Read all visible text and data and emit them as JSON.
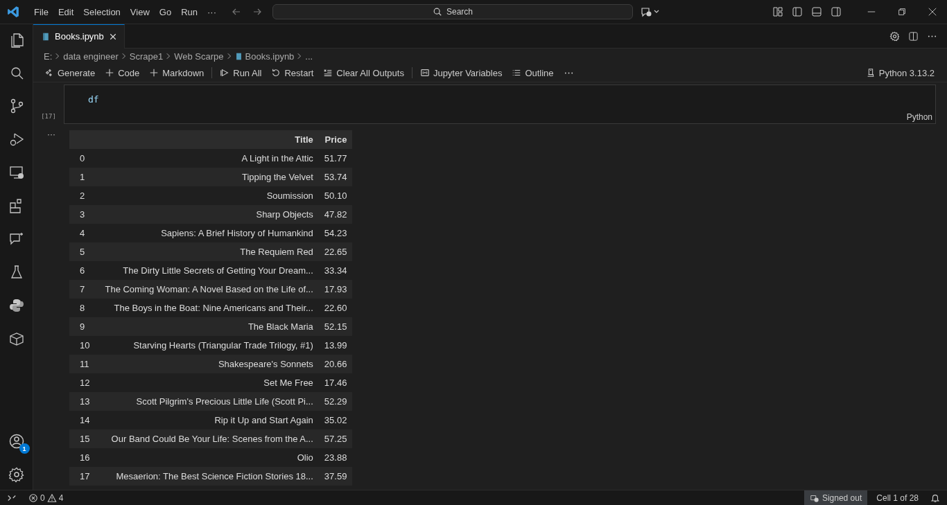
{
  "title_bar": {
    "menu": [
      "File",
      "Edit",
      "Selection",
      "View",
      "Go",
      "Run",
      "···"
    ],
    "search": "Search"
  },
  "account_badge": "1",
  "tabs": [
    {
      "label": "Books.ipynb",
      "selected": true
    }
  ],
  "breadcrumb": [
    "E:",
    "data engineer",
    "Scrape1",
    "Web Scarpe",
    "Books.ipynb",
    "..."
  ],
  "toolbar": [
    "Generate",
    "Code",
    "Markdown",
    "Run All",
    "Restart",
    "Clear All Outputs",
    "Jupyter Variables",
    "Outline"
  ],
  "kernel": "Python 3.13.2",
  "cell": {
    "execution_count": "[17]",
    "code": "df",
    "language": "Python",
    "output_menu": "···"
  },
  "table": {
    "columns": [
      "",
      "Title",
      "Price"
    ],
    "rows": [
      [
        "0",
        "A Light in the Attic",
        "51.77"
      ],
      [
        "1",
        "Tipping the Velvet",
        "53.74"
      ],
      [
        "2",
        "Soumission",
        "50.10"
      ],
      [
        "3",
        "Sharp Objects",
        "47.82"
      ],
      [
        "4",
        "Sapiens: A Brief History of Humankind",
        "54.23"
      ],
      [
        "5",
        "The Requiem Red",
        "22.65"
      ],
      [
        "6",
        "The Dirty Little Secrets of Getting Your Dream...",
        "33.34"
      ],
      [
        "7",
        "The Coming Woman: A Novel Based on the Life of...",
        "17.93"
      ],
      [
        "8",
        "The Boys in the Boat: Nine Americans and Their...",
        "22.60"
      ],
      [
        "9",
        "The Black Maria",
        "52.15"
      ],
      [
        "10",
        "Starving Hearts (Triangular Trade Trilogy, #1)",
        "13.99"
      ],
      [
        "11",
        "Shakespeare's Sonnets",
        "20.66"
      ],
      [
        "12",
        "Set Me Free",
        "17.46"
      ],
      [
        "13",
        "Scott Pilgrim's Precious Little Life (Scott Pi...",
        "52.29"
      ],
      [
        "14",
        "Rip it Up and Start Again",
        "35.02"
      ],
      [
        "15",
        "Our Band Could Be Your Life: Scenes from the A...",
        "57.25"
      ],
      [
        "16",
        "Olio",
        "23.88"
      ],
      [
        "17",
        "Mesaerion: The Best Science Fiction Stories 18...",
        "37.59"
      ]
    ]
  },
  "status_bar": {
    "errors": "0",
    "warnings": "4",
    "account": "Signed out",
    "cell_position": "Cell 1 of 28"
  }
}
